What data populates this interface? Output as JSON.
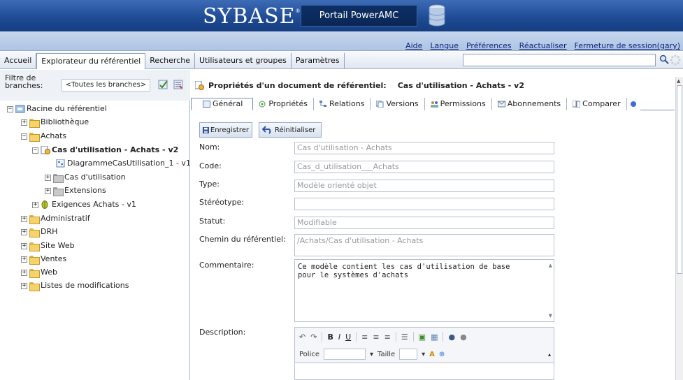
{
  "header": {
    "brand": "SYBASE",
    "brand_mark": "®",
    "portal_title": "Portail PowerAMC"
  },
  "toplinks": [
    "Aide",
    "Langue",
    "Préférences",
    "Réactualiser",
    "Fermeture de session(gary)"
  ],
  "nav": {
    "tabs": [
      "Accueil",
      "Explorateur du référentiel",
      "Recherche",
      "Utilisateurs et groupes",
      "Paramètres"
    ],
    "active": "Explorateur du référentiel",
    "search_value": ""
  },
  "filter": {
    "label": "Filtre de branches:",
    "value": "<Toutes les branches>"
  },
  "tree": {
    "root": "Racine du référentiel",
    "items": [
      "Bibliothèque",
      "Achats",
      "Cas d'utilisation - Achats - v2",
      "DiagrammeCasUtilisation_1 - v1",
      "Cas d'utilisation",
      "Extensions",
      "Exigences Achats - v1",
      "Administratif",
      "DRH",
      "Site Web",
      "Ventes",
      "Web",
      "Listes de modifications"
    ]
  },
  "doc": {
    "title_prefix": "Propriétés d'un document de référentiel:",
    "title_name": "Cas d'utilisation - Achats - v2",
    "tabs": [
      "Général",
      "Propriétés",
      "Relations",
      "Versions",
      "Permissions",
      "Abonnements",
      "Comparer"
    ],
    "active_tab": "Général",
    "buttons": {
      "save": "Enregistrer",
      "reset": "Réinitialiser"
    },
    "fields": {
      "nom_label": "Nom:",
      "nom_value": "Cas d'utilisation - Achats",
      "code_label": "Code:",
      "code_value": "Cas_d_utilisation___Achats",
      "type_label": "Type:",
      "type_value": "Modèle orienté objet",
      "stereotype_label": "Stéréotype:",
      "stereotype_value": "",
      "statut_label": "Statut:",
      "statut_value": "Modifiable",
      "chemin_label": "Chemin du référentiel:",
      "chemin_value": "/Achats/Cas d'utilisation - Achats",
      "commentaire_label": "Commentaire:",
      "commentaire_value": "Ce modèle contient les cas d'utilisation de base\npour le systèmes d'achats",
      "description_label": "Description:"
    },
    "editor": {
      "font_label": "Police",
      "size_label": "Taille"
    }
  },
  "colors": {
    "header_blue": "#1d4a93",
    "link_blue": "#11247e",
    "accent": "#7a8fb3"
  }
}
